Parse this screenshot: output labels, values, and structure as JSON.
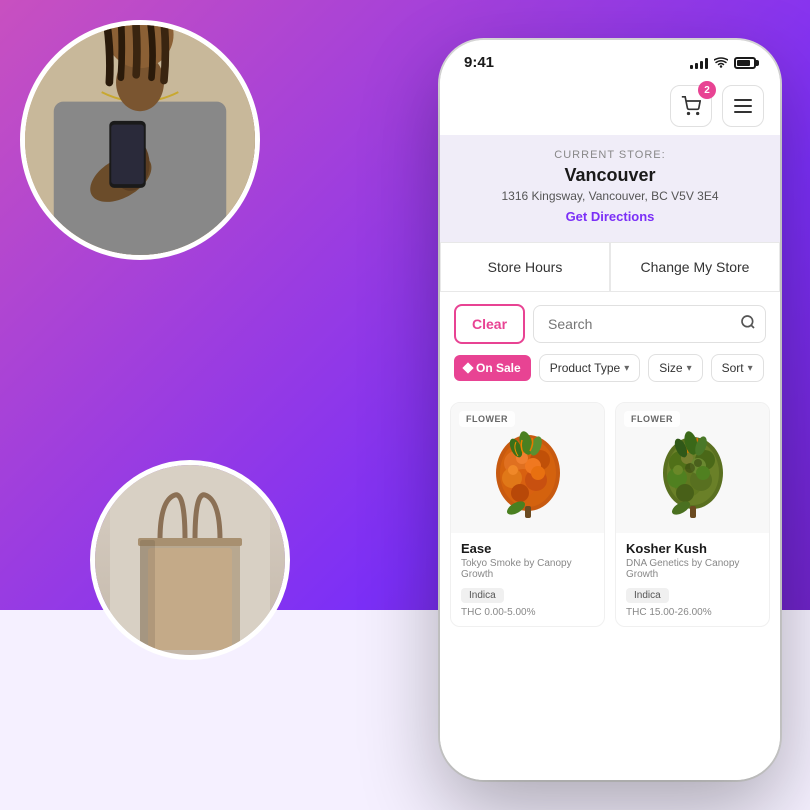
{
  "background": {
    "gradient_start": "#c850c0",
    "gradient_end": "#6a1fb5"
  },
  "phone": {
    "time": "9:41",
    "cart_badge": "2",
    "store": {
      "label": "CURRENT STORE:",
      "name": "Vancouver",
      "address": "1316 Kingsway, Vancouver, BC V5V 3E4",
      "directions_link": "Get Directions"
    },
    "actions": {
      "store_hours": "Store Hours",
      "change_store": "Change My Store"
    },
    "search": {
      "clear_label": "Clear",
      "placeholder": "Search",
      "search_icon": "🔍"
    },
    "filters": {
      "on_sale": "On Sale",
      "product_type": "Product Type",
      "size": "Size",
      "sort": "Sort"
    },
    "products": [
      {
        "badge": "FLOWER",
        "name": "Ease",
        "brand": "Tokyo Smoke by Canopy Growth",
        "type": "Indica",
        "thc": "THC 0.00-5.00%"
      },
      {
        "badge": "FLOWER",
        "name": "Kosher Kush",
        "brand": "DNA Genetics by Canopy Growth",
        "type": "Indica",
        "thc": "THC 15.00-26.00%"
      }
    ]
  }
}
